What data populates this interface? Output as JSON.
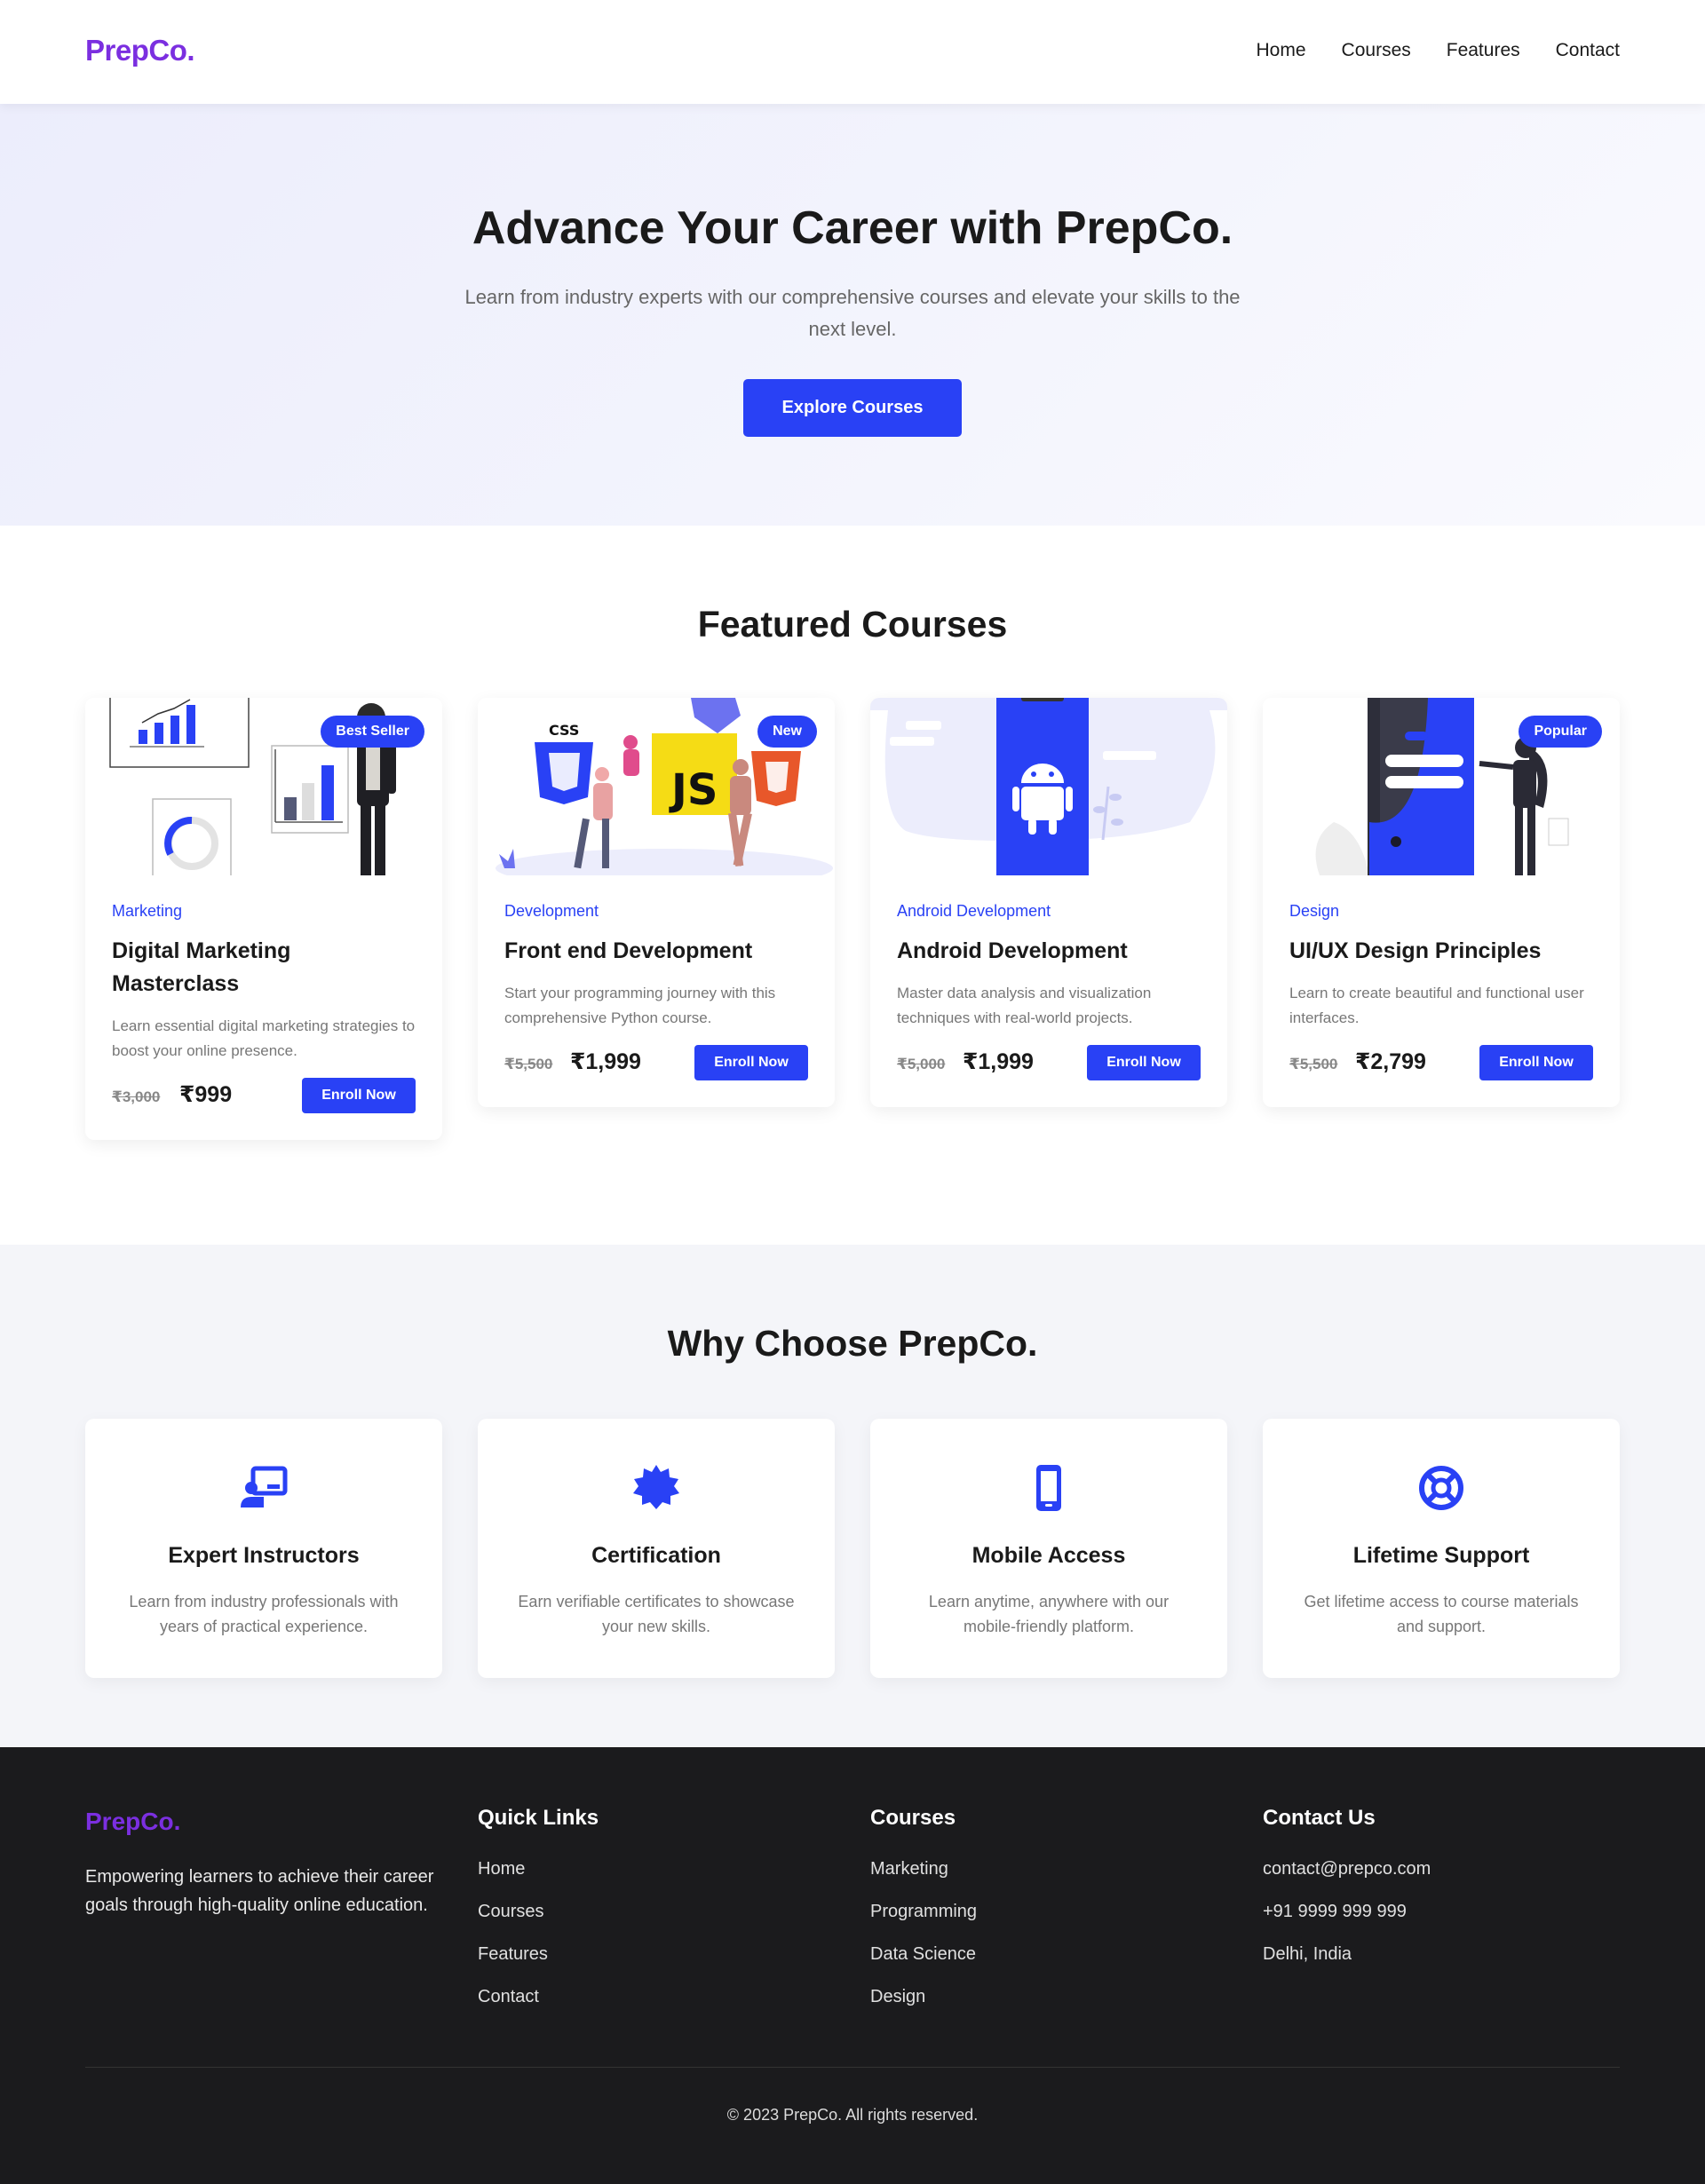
{
  "nav": {
    "logo": "PrepCo.",
    "links": [
      "Home",
      "Courses",
      "Features",
      "Contact"
    ]
  },
  "hero": {
    "title": "Advance Your Career with PrepCo.",
    "subtitle": "Learn from industry experts with our comprehensive courses and elevate your skills to the next level.",
    "cta": "Explore Courses"
  },
  "featured": {
    "title": "Featured Courses",
    "courses": [
      {
        "category": "Marketing",
        "title": "Digital Marketing Masterclass",
        "description": "Learn essential digital marketing strategies to boost your online presence.",
        "old_price": "₹3,000",
        "price": "₹999",
        "badge": "Best Seller",
        "button": "Enroll Now"
      },
      {
        "category": "Development",
        "title": "Front end Development",
        "description": "Start your programming journey with this comprehensive Python course.",
        "old_price": "₹5,500",
        "price": "₹1,999",
        "badge": "New",
        "button": "Enroll Now"
      },
      {
        "category": "Android Development",
        "title": "Android Development",
        "description": "Master data analysis and visualization techniques with real-world projects.",
        "old_price": "₹5,000",
        "price": "₹1,999",
        "badge": "",
        "button": "Enroll Now"
      },
      {
        "category": "Design",
        "title": "UI/UX Design Principles",
        "description": "Learn to create beautiful and functional user interfaces.",
        "old_price": "₹5,500",
        "price": "₹2,799",
        "badge": "Popular",
        "button": "Enroll Now"
      }
    ],
    "illustration_text": {
      "css": "CSS",
      "js": "JS"
    }
  },
  "why": {
    "title": "Why Choose PrepCo.",
    "features": [
      {
        "icon": "instructor-icon",
        "title": "Expert Instructors",
        "description": "Learn from industry professionals with years of practical experience."
      },
      {
        "icon": "certificate-icon",
        "title": "Certification",
        "description": "Earn verifiable certificates to showcase your new skills."
      },
      {
        "icon": "mobile-icon",
        "title": "Mobile Access",
        "description": "Learn anytime, anywhere with our mobile-friendly platform."
      },
      {
        "icon": "support-icon",
        "title": "Lifetime Support",
        "description": "Get lifetime access to course materials and support."
      }
    ]
  },
  "footer": {
    "logo": "PrepCo.",
    "about": "Empowering learners to achieve their career goals through high-quality online education.",
    "quick_links": {
      "title": "Quick Links",
      "items": [
        "Home",
        "Courses",
        "Features",
        "Contact"
      ]
    },
    "courses": {
      "title": "Courses",
      "items": [
        "Marketing",
        "Programming",
        "Data Science",
        "Design"
      ]
    },
    "contact": {
      "title": "Contact Us",
      "items": [
        "contact@prepco.com",
        "+91 9999 999 999",
        "Delhi, India"
      ]
    },
    "copyright": "© 2023 PrepCo. All rights reserved."
  },
  "colors": {
    "accent": "#2941f5",
    "brand": "#7b2fe0",
    "footer_bg": "#1b1b1d",
    "section_bg": "#f4f5f9"
  }
}
